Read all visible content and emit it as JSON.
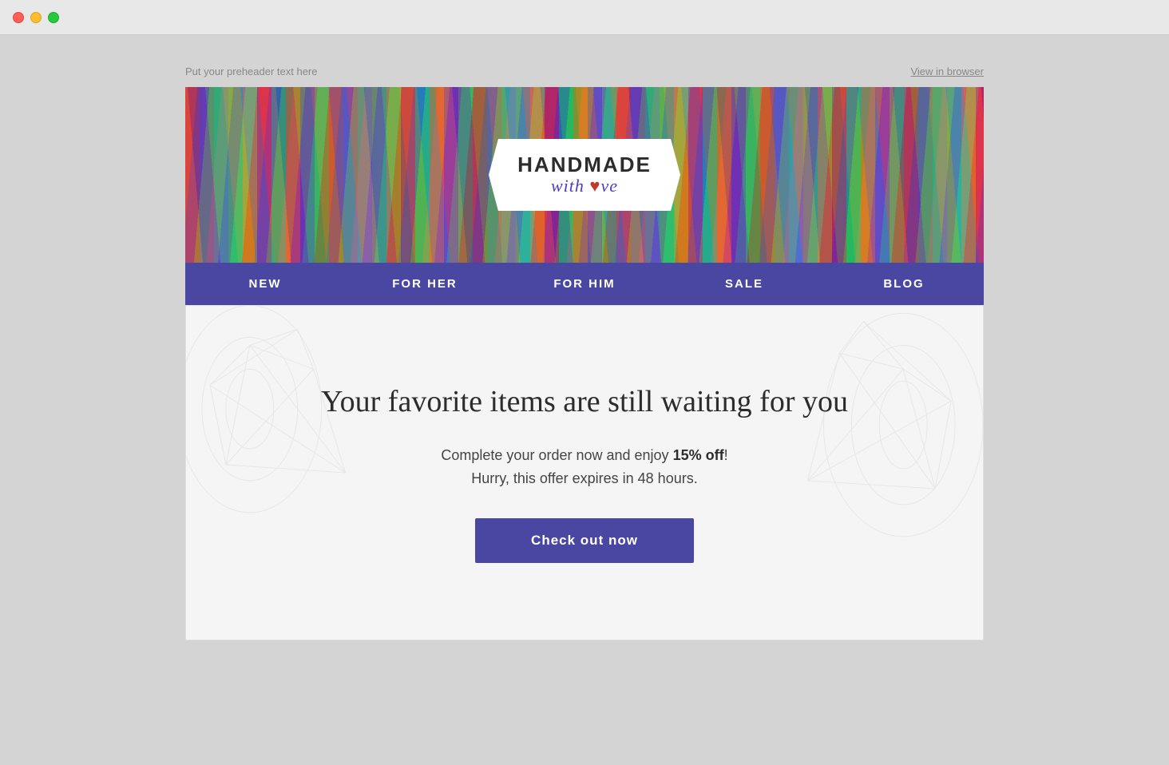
{
  "titlebar": {
    "traffic_lights": {
      "close": "close",
      "minimize": "minimize",
      "maximize": "maximize"
    }
  },
  "preheader": {
    "text": "Put your preheader text here",
    "view_in_browser": "View in browser"
  },
  "header": {
    "logo_main": "HANDMADE",
    "logo_sub": "with love",
    "logo_heart": "♥"
  },
  "nav": {
    "items": [
      {
        "label": "NEW"
      },
      {
        "label": "FOR HER"
      },
      {
        "label": "FOR HIM"
      },
      {
        "label": "SALE"
      },
      {
        "label": "BLOG"
      }
    ]
  },
  "main": {
    "headline": "Your favorite items are still waiting for you",
    "subtext_prefix": "Complete your order now and enjoy ",
    "subtext_bold": "15% off",
    "subtext_suffix": "!",
    "subtext_line2": "Hurry, this offer expires in 48 hours.",
    "cta_label": "Check out now"
  }
}
